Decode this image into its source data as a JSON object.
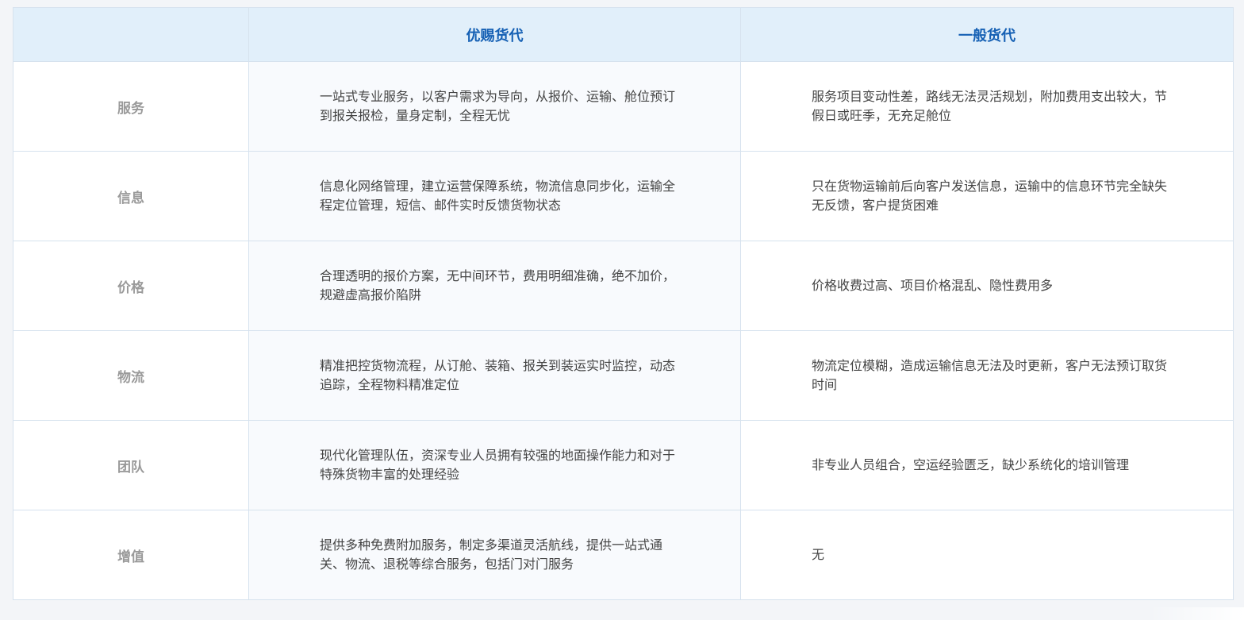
{
  "table": {
    "columns": [
      "",
      "优赐货代",
      "一般货代"
    ],
    "rows": [
      {
        "label": "服务",
        "ours": "一站式专业服务，以客户需求为导向，从报价、运输、舱位预订到报关报检，量身定制，全程无忧",
        "theirs": "服务项目变动性差，路线无法灵活规划，附加费用支出较大，节假日或旺季，无充足舱位"
      },
      {
        "label": "信息",
        "ours": "信息化网络管理，建立运营保障系统，物流信息同步化，运输全程定位管理，短信、邮件实时反馈货物状态",
        "theirs": "只在货物运输前后向客户发送信息，运输中的信息环节完全缺失无反馈，客户提货困难"
      },
      {
        "label": "价格",
        "ours": "合理透明的报价方案，无中间环节，费用明细准确，绝不加价，规避虚高报价陷阱",
        "theirs": "价格收费过高、项目价格混乱、隐性费用多"
      },
      {
        "label": "物流",
        "ours": "精准把控货物流程，从订舱、装箱、报关到装运实时监控，动态追踪，全程物料精准定位",
        "theirs": "物流定位模糊，造成运输信息无法及时更新，客户无法预订取货时间"
      },
      {
        "label": "团队",
        "ours": "现代化管理队伍，资深专业人员拥有较强的地面操作能力和对于特殊货物丰富的处理经验",
        "theirs": "非专业人员组合，空运经验匮乏，缺少系统化的培训管理"
      },
      {
        "label": "增值",
        "ours": "提供多种免费附加服务，制定多渠道灵活航线，提供一站式通关、物流、退税等综合服务，包括门对门服务",
        "theirs": "无"
      }
    ]
  },
  "colors": {
    "header_bg": "#e1effa",
    "header_text": "#1560b4",
    "label_text": "#9a9a9a",
    "body_text": "#444444",
    "border": "#d6e2ee"
  }
}
